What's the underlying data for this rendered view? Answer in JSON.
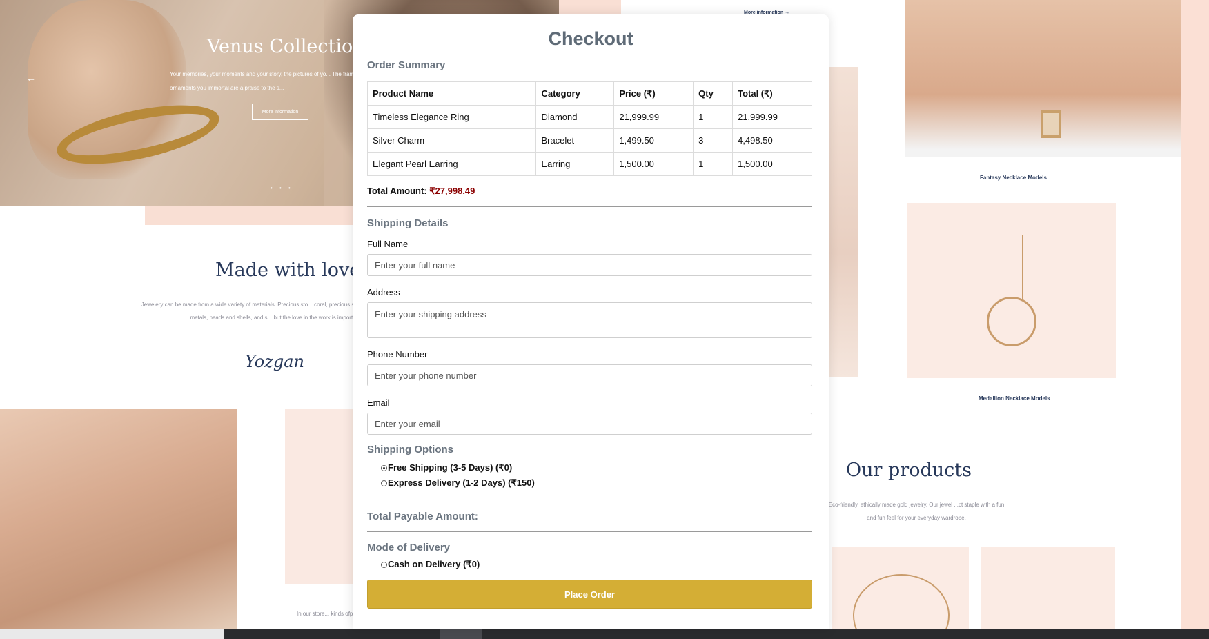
{
  "background": {
    "hero_title": "Venus Collection",
    "hero_subtitle": "Your memories, your moments and your story, the pictures of yo... The frame ornaments you immortal are a praise to the s...",
    "hero_button": "More information",
    "hero_prev_arrow": "←",
    "hero_dots": "• • •",
    "made_title": "Made with love",
    "made_text": "Jewelery can be made from a wide variety of materials. Precious sto... coral, precious stones such as precious metals, beads and shells, and s... but the love in the work is important.",
    "signature": "Yozgan",
    "bottom_text": "In our store... kinds ofproducts fo...",
    "more_info": "More information  →",
    "necklace_label_1": "Fantasy Necklace Models",
    "necklace_label_2": "Medallion Necklace Models",
    "products_title": "Our products",
    "products_text": "Eco-friendly, ethically made gold jewelry. Our jewel ...ct staple with a fun and fun feel for your everyday wardrobe."
  },
  "checkout": {
    "title": "Checkout",
    "order_summary": {
      "heading": "Order Summary",
      "columns": [
        "Product Name",
        "Category",
        "Price (₹)",
        "Qty",
        "Total (₹)"
      ],
      "rows": [
        [
          "Timeless Elegance Ring",
          "Diamond",
          "21,999.99",
          "1",
          "21,999.99"
        ],
        [
          "Silver Charm",
          "Bracelet",
          "1,499.50",
          "3",
          "4,498.50"
        ],
        [
          "Elegant Pearl Earring",
          "Earring",
          "1,500.00",
          "1",
          "1,500.00"
        ]
      ],
      "total_label": "Total Amount:",
      "total_value": "₹27,998.49"
    },
    "shipping": {
      "heading": "Shipping Details",
      "full_name_label": "Full Name",
      "full_name_placeholder": "Enter your full name",
      "address_label": "Address",
      "address_placeholder": "Enter your shipping address",
      "phone_label": "Phone Number",
      "phone_placeholder": "Enter your phone number",
      "email_label": "Email",
      "email_placeholder": "Enter your email"
    },
    "shipping_options": {
      "heading": "Shipping Options",
      "free": "Free Shipping (3-5 Days) (₹0)",
      "express": "Express Delivery (1-2 Days) (₹150)",
      "selected": "free"
    },
    "payable_label": "Total Payable Amount:",
    "delivery": {
      "heading": "Mode of Delivery",
      "cod": "Cash on Delivery (₹0)"
    },
    "place_order": "Place Order"
  },
  "colors": {
    "button_gold": "#d4ae35",
    "total_red": "#8b0000",
    "heading_gray": "#6b7580"
  }
}
